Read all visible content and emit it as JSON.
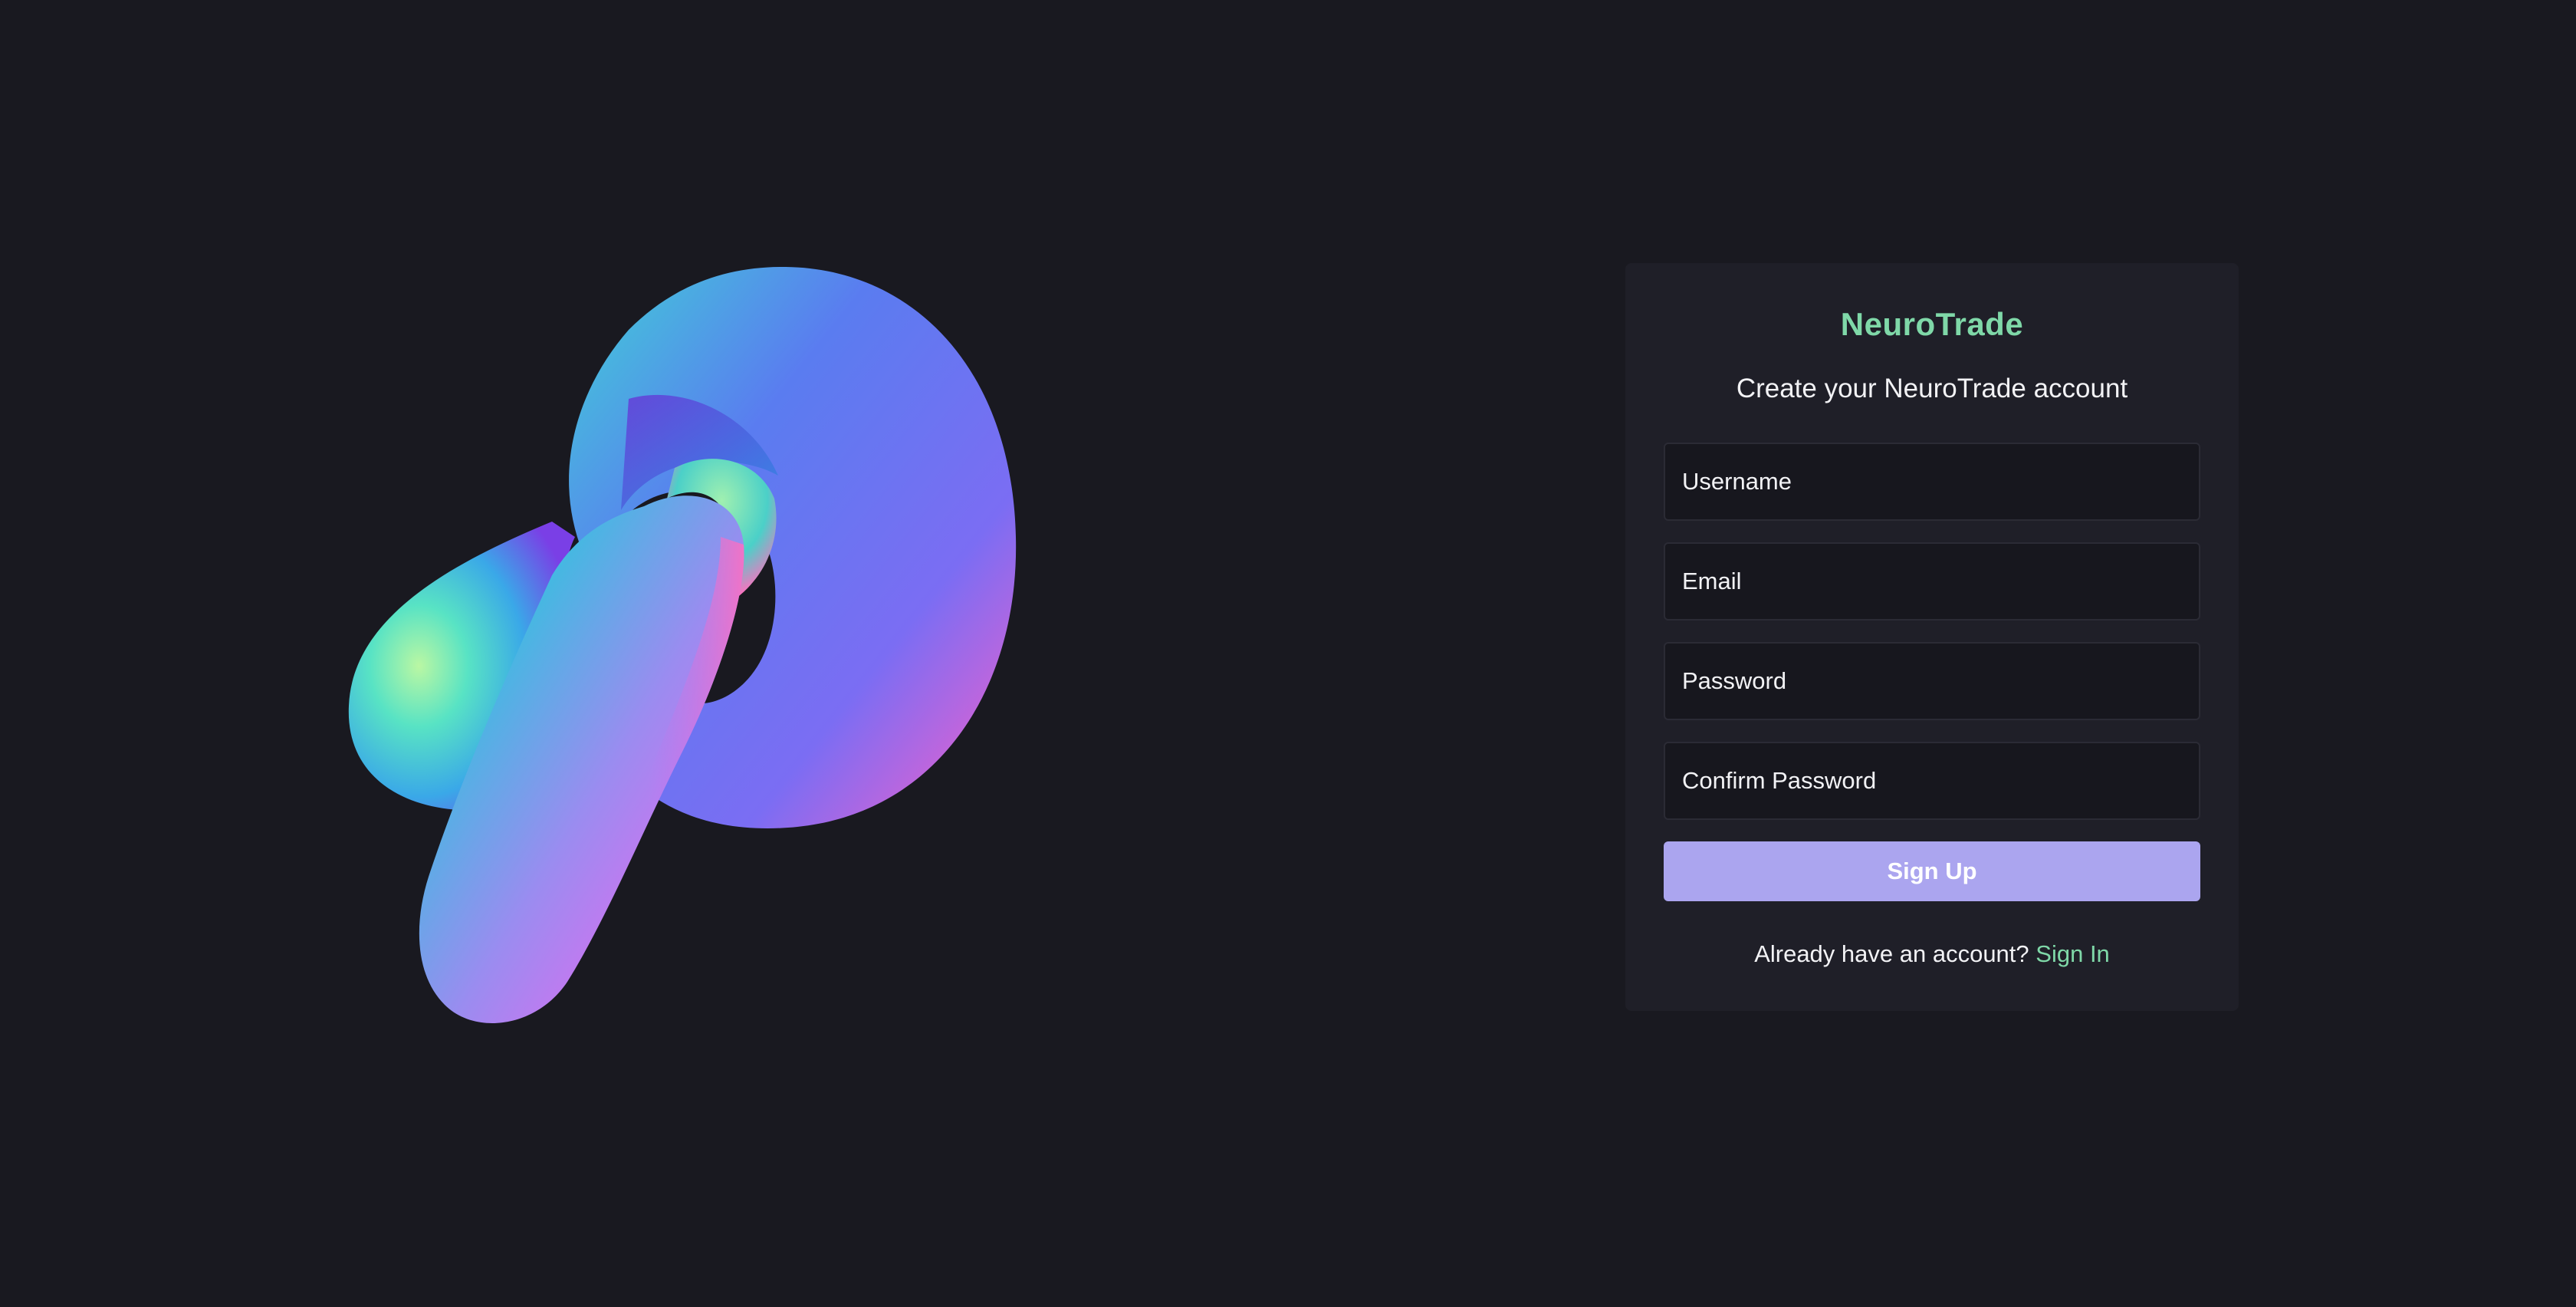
{
  "app": {
    "brand": "NeuroTrade"
  },
  "form": {
    "subtitle": "Create your NeuroTrade account",
    "username_placeholder": "Username",
    "email_placeholder": "Email",
    "password_placeholder": "Password",
    "confirm_password_placeholder": "Confirm Password",
    "submit_label": "Sign Up",
    "footer_text": "Already have an account?",
    "footer_link": "Sign In"
  },
  "colors": {
    "background": "#191920",
    "card": "#1f1f28",
    "brand_accent": "#7fd8a8",
    "button": "#aba5ef"
  },
  "illustration": {
    "icon": "torus-knot-icon"
  }
}
